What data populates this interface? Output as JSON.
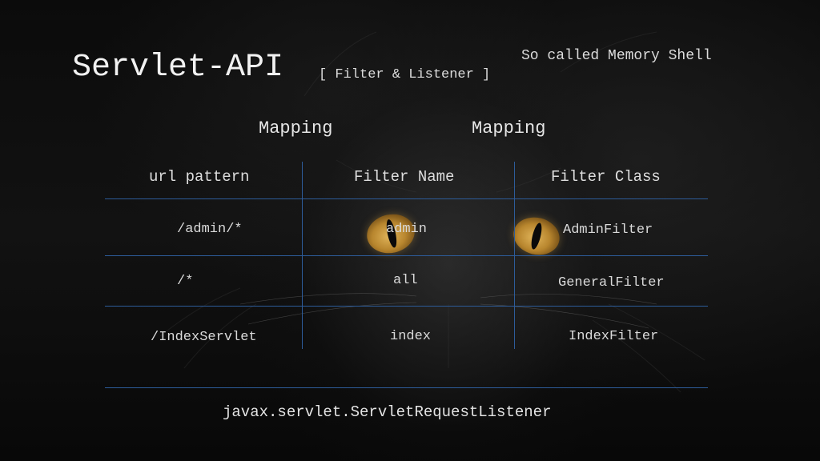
{
  "slide": {
    "title": "Servlet-API",
    "subtitle": "[ Filter & Listener ]",
    "note": "So called Memory Shell",
    "mapping_labels": [
      "Mapping",
      "Mapping"
    ],
    "table": {
      "headers": [
        "url pattern",
        "Filter Name",
        "Filter Class"
      ],
      "rows": [
        [
          "/admin/*",
          "admin",
          "AdminFilter"
        ],
        [
          "/*",
          "all",
          "GeneralFilter"
        ],
        [
          "/IndexServlet",
          "index",
          "IndexFilter"
        ]
      ]
    },
    "listener": "javax.servlet.ServletRequestListener"
  },
  "colors": {
    "grid_line": "#2d5c9a",
    "eye": "#d9a84e"
  },
  "icons": [
    "cat-eye-icon"
  ]
}
